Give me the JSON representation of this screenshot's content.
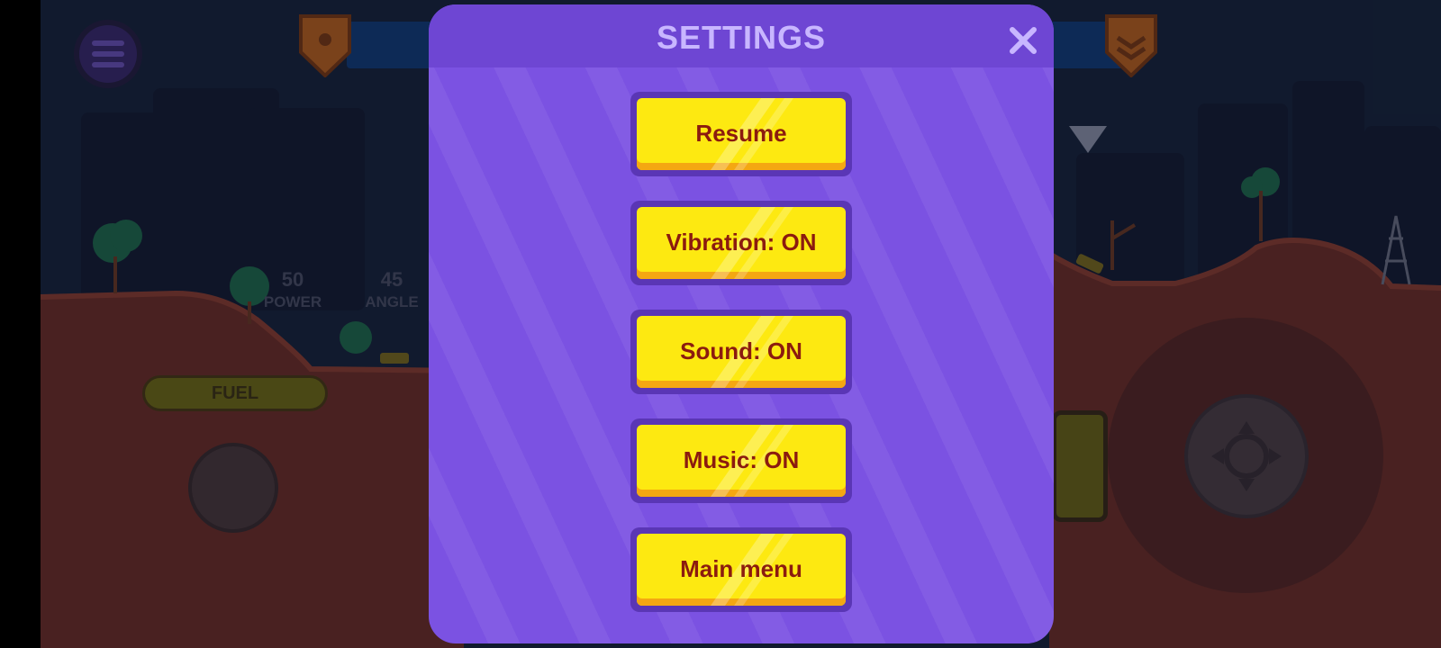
{
  "hud": {
    "power": {
      "value": "50",
      "label": "POWER"
    },
    "angle": {
      "value": "45",
      "label": "ANGLE"
    },
    "fuel_label": "FUEL"
  },
  "icons": {
    "menu": "hamburger-menu-icon",
    "close": "close-icon",
    "player_badge": "rank-shield-icon",
    "enemy_badge": "rank-shield-icon",
    "target": "crosshair-icon",
    "drop_marker": "triangle-down-icon"
  },
  "dialog": {
    "title": "SETTINGS",
    "options": [
      {
        "label": "Resume"
      },
      {
        "label": "Vibration: ON"
      },
      {
        "label": "Sound: ON"
      },
      {
        "label": "Music: ON"
      },
      {
        "label": "Main menu"
      }
    ]
  },
  "colors": {
    "dialog_bg": "#7b52e2",
    "dialog_header": "#6e46d3",
    "button_yellow": "#fde911",
    "button_text": "#8b1b0f",
    "terrain": "#6e2f25"
  }
}
